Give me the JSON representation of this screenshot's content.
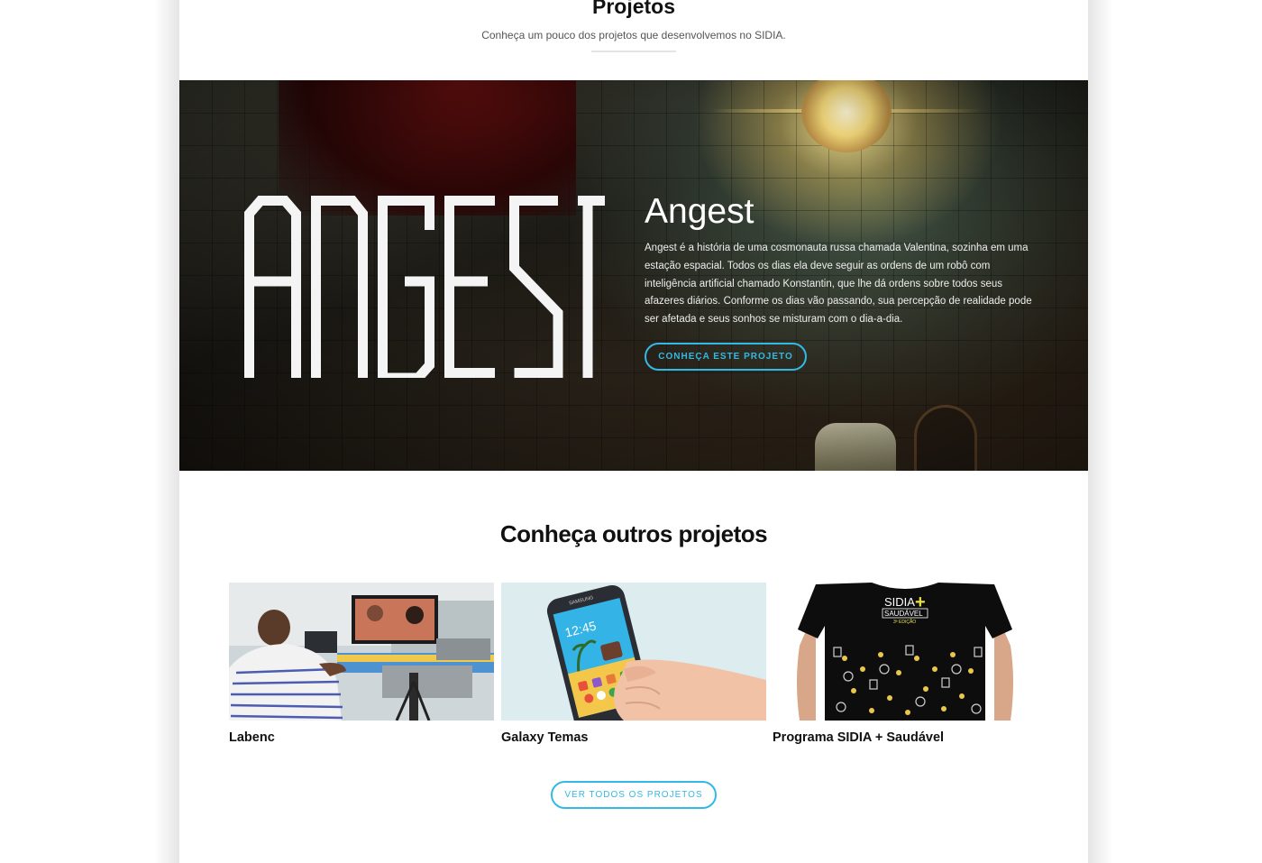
{
  "section": {
    "title": "Projetos",
    "subtitle": "Conheça um pouco dos projetos que desenvolvemos no SIDIA."
  },
  "featured": {
    "logo_text": "ANGEST",
    "title": "Angest",
    "description": "Angest é a história de uma cosmonauta russa chamada Valentina, sozinha em uma estação espacial. Todos os dias ela deve seguir as ordens de um robô com inteligência artificial chamado Konstantin, que lhe dá ordens sobre todos seus afazeres diários. Conforme os dias vão passando, sua percepção de realidade pode ser afetada e seus sonhos se misturam com o dia-a-dia.",
    "button_label": "CONHEÇA ESTE PROJETO"
  },
  "others": {
    "title": "Conheça outros projetos",
    "projects": [
      {
        "label": "Labenc"
      },
      {
        "label": "Galaxy Temas",
        "phone_time": "12:45",
        "phone_brand": "SAMSUNG"
      },
      {
        "label": "Programa SIDIA + Saudável",
        "shirt_line1": "SIDIA",
        "shirt_plus": "+",
        "shirt_line2": "SAUDÁVEL",
        "shirt_line3": "3ª EDIÇÃO"
      }
    ],
    "all_button_label": "VER TODOS OS PROJETOS"
  },
  "colors": {
    "accent": "#33b9e6",
    "heading": "#111111",
    "background": "#ffffff"
  }
}
